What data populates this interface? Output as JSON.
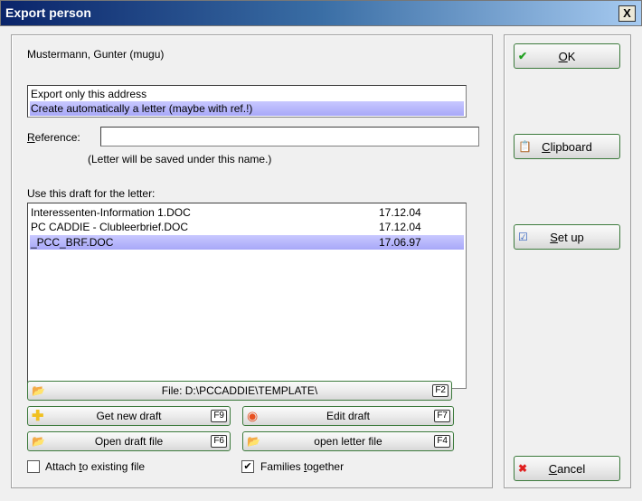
{
  "window": {
    "title": "Export person",
    "close": "X"
  },
  "person": "Mustermann, Gunter (mugu)",
  "mode_options": [
    {
      "label": "Export only this address",
      "selected": false
    },
    {
      "label": "Create automatically a letter (maybe with ref.!)",
      "selected": true
    }
  ],
  "reference": {
    "label": "Reference:",
    "value": "",
    "note": "(Letter will be saved under this name.)"
  },
  "drafts": {
    "label": "Use this draft for the letter:",
    "items": [
      {
        "name": "Interessenten-Information 1.DOC",
        "date": "17.12.04",
        "selected": false
      },
      {
        "name": "PC CADDIE - Clubleerbrief.DOC",
        "date": "17.12.04",
        "selected": false
      },
      {
        "name": "_PCC_BRF.DOC",
        "date": "17.06.97",
        "selected": true
      }
    ]
  },
  "buttons": {
    "file": {
      "label": "File: D:\\PCCADDIE\\TEMPLATE\\",
      "key": "F2"
    },
    "get_new": {
      "label": "Get new draft",
      "key": "F9"
    },
    "edit": {
      "label": "Edit draft",
      "key": "F7"
    },
    "open_draft": {
      "label": "Open draft file",
      "key": "F6"
    },
    "open_letter": {
      "label": "open letter file",
      "key": "F4"
    },
    "ok": "OK",
    "clipboard": "Clipboard",
    "setup": "Set up",
    "cancel": "Cancel"
  },
  "checkboxes": {
    "attach": {
      "label": "Attach to existing file",
      "checked": false
    },
    "families": {
      "label": "Families together",
      "checked": true
    }
  }
}
